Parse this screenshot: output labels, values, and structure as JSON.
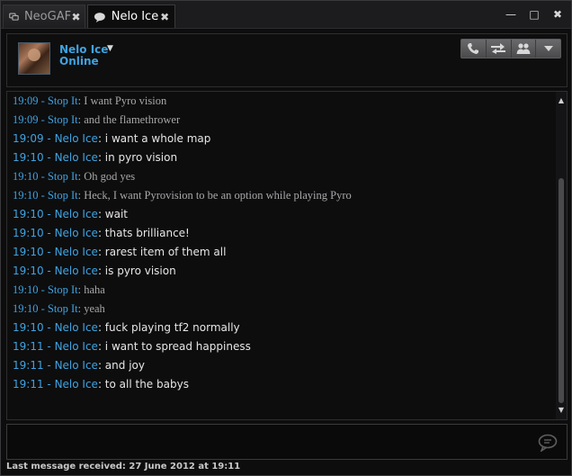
{
  "tabs": [
    {
      "label": "NeoGAF",
      "icon": "group-chat-icon",
      "close": "✖"
    },
    {
      "label": "Nelo Ice",
      "icon": "chat-bubble-icon",
      "close": "✖"
    }
  ],
  "window_controls": {
    "minimize": "—",
    "maximize": "□",
    "close": "✖"
  },
  "contact": {
    "name": "Nelo Ice",
    "status": "Online",
    "dropdown": "▼"
  },
  "actions": [
    {
      "name": "call-icon"
    },
    {
      "name": "transfer-icon"
    },
    {
      "name": "add-users-icon"
    },
    {
      "name": "more-dropdown-icon"
    }
  ],
  "messages": [
    {
      "time": "19:09",
      "sender": "Stop It",
      "text": "I want Pyro vision",
      "peer": true
    },
    {
      "time": "19:09",
      "sender": "Stop It",
      "text": "and the flamethrower",
      "peer": true
    },
    {
      "time": "19:09",
      "sender": "Nelo Ice",
      "text": "i want a whole map",
      "peer": false
    },
    {
      "time": "19:10",
      "sender": "Nelo Ice",
      "text": "in pyro vision",
      "peer": false
    },
    {
      "time": "19:10",
      "sender": "Stop It",
      "text": "Oh god yes",
      "peer": true
    },
    {
      "time": "19:10",
      "sender": "Stop It",
      "text": "Heck, I want Pyrovision to be an option while playing Pyro",
      "peer": true
    },
    {
      "time": "19:10",
      "sender": "Nelo Ice",
      "text": "wait",
      "peer": false
    },
    {
      "time": "19:10",
      "sender": "Nelo Ice",
      "text": "thats brilliance!",
      "peer": false
    },
    {
      "time": "19:10",
      "sender": "Nelo Ice",
      "text": "rarest item of them all",
      "peer": false
    },
    {
      "time": "19:10",
      "sender": "Nelo Ice",
      "text": "is pyro vision",
      "peer": false
    },
    {
      "time": "19:10",
      "sender": "Stop It",
      "text": "haha",
      "peer": true
    },
    {
      "time": "19:10",
      "sender": "Stop It",
      "text": "yeah",
      "peer": true
    },
    {
      "time": "19:10",
      "sender": "Nelo Ice",
      "text": "fuck playing tf2 normally",
      "peer": false
    },
    {
      "time": "19:11",
      "sender": "Nelo Ice",
      "text": "i want to spread happiness",
      "peer": false
    },
    {
      "time": "19:11",
      "sender": "Nelo Ice",
      "text": "and joy",
      "peer": false
    },
    {
      "time": "19:11",
      "sender": "Nelo Ice",
      "text": "to all the babys",
      "peer": false
    }
  ],
  "input": {
    "value": "",
    "placeholder": ""
  },
  "status_bar": "Last message received: 27 June 2012 at 19:11",
  "colors": {
    "accent": "#3fa3e0",
    "background": "#0d0d0e",
    "peer_text": "#a8a8aa",
    "self_text": "#e6e6e6"
  }
}
